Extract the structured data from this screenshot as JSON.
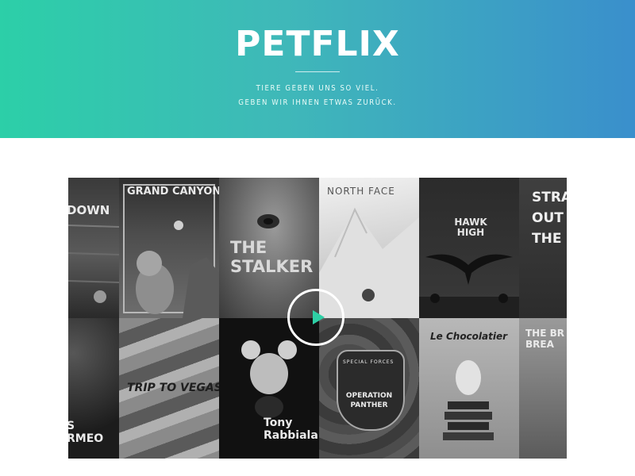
{
  "header": {
    "logo": "PETFLIX",
    "tagline_line1": "TIERE GEBEN UNS SO VIEL.",
    "tagline_line2": "GEBEN WIR IHNEN ETWAS ZURÜCK.",
    "gradient_start": "#2ccfa8",
    "gradient_end": "#3a8fcc"
  },
  "mosaic": {
    "posters": [
      {
        "title": "DOWN"
      },
      {
        "title": "GRAND CANYON"
      },
      {
        "title": "THE STALKER"
      },
      {
        "title": "NORTH FACE"
      },
      {
        "title": "HAWK HIGH"
      },
      {
        "title": "STRAIGHT OUT THE"
      },
      {
        "title": "S RMEO"
      },
      {
        "title": "TRIP TO VEGAS"
      },
      {
        "title": "Tony Rabbiala"
      },
      {
        "title": "SPECIAL FORCES",
        "subtitle": "OPERATION PANTHER"
      },
      {
        "title": "Le Chocolatier"
      },
      {
        "title": "THE BR BREA"
      }
    ],
    "play_icon": "play-icon",
    "play_color": "#2ecfa5"
  }
}
